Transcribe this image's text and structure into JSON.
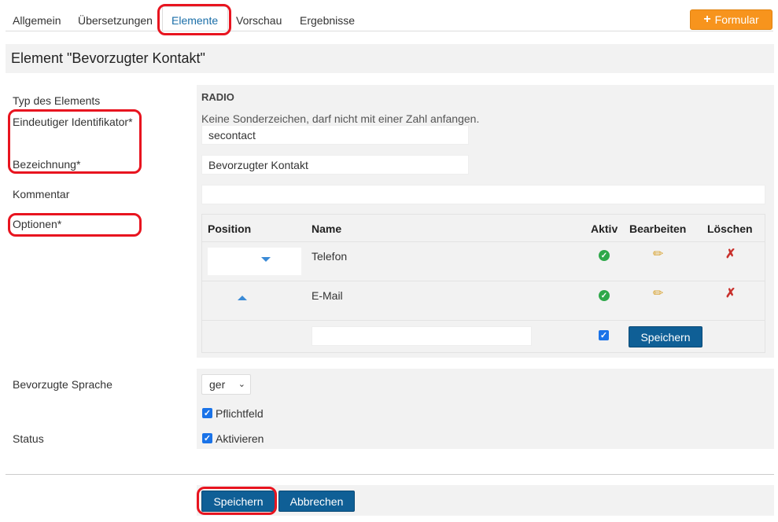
{
  "tabs": [
    {
      "label": "Allgemein"
    },
    {
      "label": "Übersetzungen"
    },
    {
      "label": "Elemente"
    },
    {
      "label": "Vorschau"
    },
    {
      "label": "Ergebnisse"
    }
  ],
  "formular_button": {
    "label": "Formular",
    "icon": "plus-icon"
  },
  "page_title": "Element \"Bevorzugter Kontakt\"",
  "labels": {
    "type": "Typ des Elements",
    "identifier": "Eindeutiger Identifikator*",
    "name": "Bezeichnung*",
    "comment": "Kommentar",
    "options": "Optionen*",
    "language": "Bevorzugte Sprache",
    "status": "Status"
  },
  "element_type": "RADIO",
  "identifier_hint": "Keine Sonderzeichen, darf nicht mit einer Zahl anfangen.",
  "identifier_value": "secontact",
  "name_value": "Bevorzugter Kontakt",
  "comment_value": "",
  "options_table": {
    "headers": {
      "position": "Position",
      "name": "Name",
      "active": "Aktiv",
      "edit": "Bearbeiten",
      "delete": "Löschen"
    },
    "rows": [
      {
        "name": "Telefon",
        "active": true
      },
      {
        "name": "E-Mail",
        "active": true
      }
    ],
    "new_row": {
      "name_value": "",
      "active_checked": true,
      "save_label": "Speichern"
    }
  },
  "language_select": {
    "value": "ger"
  },
  "required_checkbox": {
    "label": "Pflichtfeld",
    "checked": true
  },
  "activate_checkbox": {
    "label": "Aktivieren",
    "checked": true
  },
  "footer": {
    "save_label": "Speichern",
    "cancel_label": "Abbrechen"
  },
  "colors": {
    "accent": "#1a6ea8",
    "orange": "#f7941d",
    "primary_button": "#0f5f96",
    "highlight": "#e8141f"
  }
}
